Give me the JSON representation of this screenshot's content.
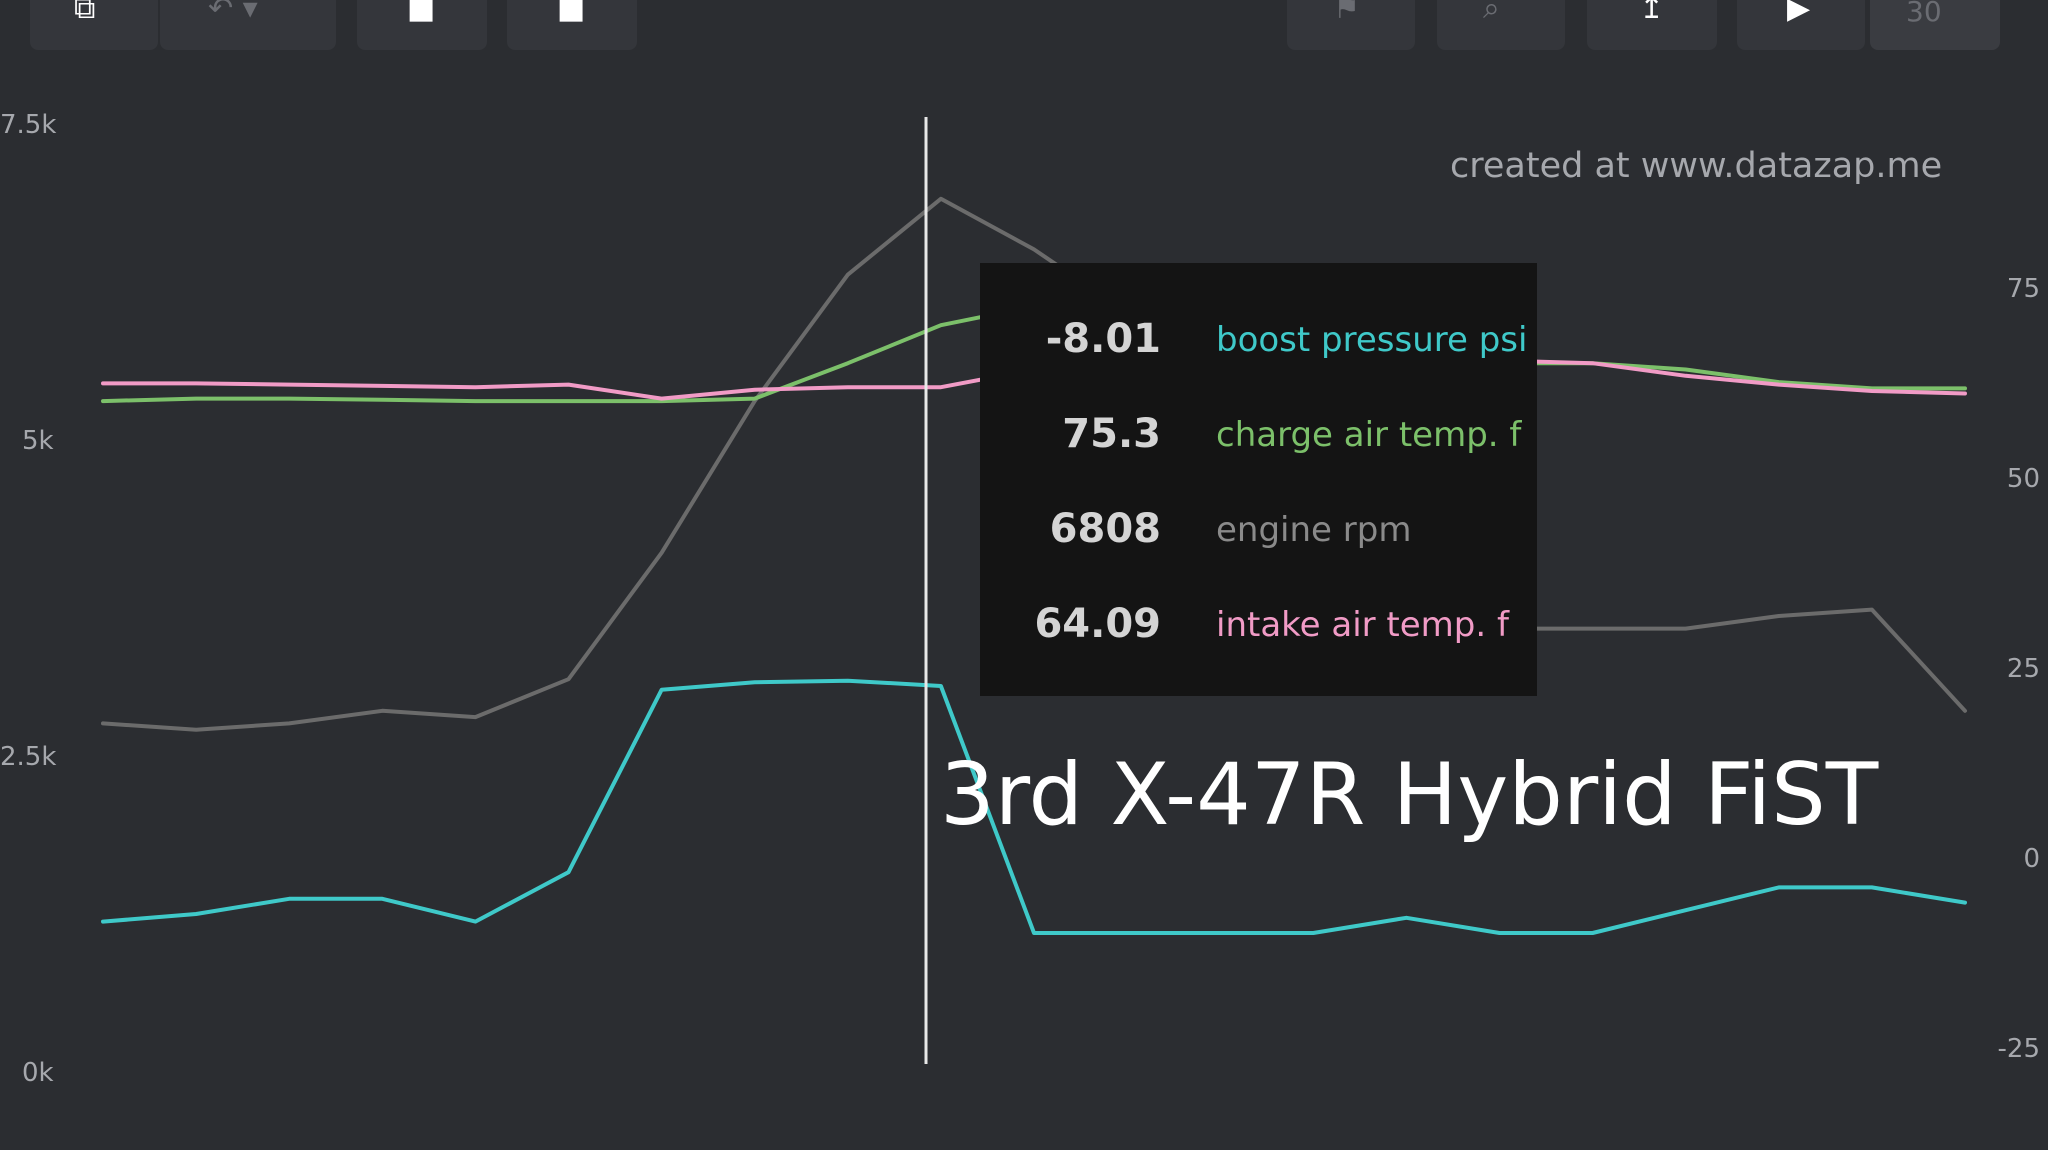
{
  "toolbar": {
    "buttons": [
      {
        "name": "share-icon",
        "glyph": "⧉"
      },
      {
        "name": "undo-icon",
        "glyph": "↶ ▾"
      },
      {
        "name": "square-icon",
        "glyph": "■"
      },
      {
        "name": "square-icon",
        "glyph": "■"
      },
      {
        "name": "flag-icon",
        "glyph": "⚑"
      },
      {
        "name": "search-icon",
        "glyph": "⌕"
      },
      {
        "name": "pin-icon",
        "glyph": "↥"
      },
      {
        "name": "play-icon",
        "glyph": "▶"
      },
      {
        "name": "speed-field",
        "glyph": "30"
      }
    ]
  },
  "watermark": "created at www.datazap.me",
  "title_overlay": "3rd X-47R Hybrid FiST",
  "tooltip": {
    "rows": [
      {
        "value": "-8.01",
        "label": "boost pressure psi",
        "color": "#3fc9c9"
      },
      {
        "value": "75.3",
        "label": "charge air temp. f",
        "color": "#7cc06a"
      },
      {
        "value": "6808",
        "label": "engine rpm",
        "color": "#8a8a8a"
      },
      {
        "value": "64.09",
        "label": "intake air temp. f",
        "color": "#f19bc6"
      }
    ]
  },
  "chart_data": {
    "type": "line",
    "left_axis": {
      "ticks": [
        "7.5k",
        "5k",
        "2.5k",
        "0k"
      ],
      "tick_values": [
        7500,
        5000,
        2500,
        0
      ],
      "ylim": [
        0,
        7500
      ]
    },
    "right_axis": {
      "ticks": [
        "75",
        "50",
        "25",
        "0",
        "-25"
      ],
      "tick_values": [
        75,
        50,
        25,
        0,
        -25
      ],
      "ylim": [
        -25,
        100
      ]
    },
    "x": [
      0,
      0.05,
      0.1,
      0.15,
      0.2,
      0.25,
      0.3,
      0.35,
      0.4,
      0.45,
      0.5,
      0.55,
      0.6,
      0.65,
      0.7,
      0.75,
      0.8,
      0.85,
      0.9,
      0.95,
      1.0
    ],
    "cursor_x": 0.442,
    "series": [
      {
        "name": "engine rpm",
        "axis": "left",
        "color": "#6b6b6b",
        "values": [
          2750,
          2700,
          2750,
          2850,
          2800,
          3100,
          4100,
          5300,
          6300,
          6900,
          6500,
          6000,
          5200,
          4500,
          3650,
          3500,
          3500,
          3500,
          3600,
          3650,
          2850
        ]
      },
      {
        "name": "charge air temp. f",
        "axis": "left",
        "color": "#7cc06a",
        "values": [
          5300,
          5320,
          5320,
          5310,
          5300,
          5300,
          5300,
          5320,
          5600,
          5900,
          6050,
          5900,
          5800,
          5700,
          5650,
          5600,
          5600,
          5550,
          5450,
          5400,
          5400
        ]
      },
      {
        "name": "intake air temp. f",
        "axis": "left",
        "color": "#f19bc6",
        "values": [
          5440,
          5440,
          5430,
          5420,
          5410,
          5430,
          5320,
          5390,
          5410,
          5410,
          5550,
          5600,
          5620,
          5620,
          5620,
          5620,
          5600,
          5500,
          5430,
          5380,
          5360
        ]
      },
      {
        "name": "boost pressure psi",
        "axis": "right",
        "color": "#3fc9c9",
        "values": [
          -8.5,
          -7.5,
          -5.5,
          -5.5,
          -8.5,
          -2,
          22,
          23,
          23.2,
          22.5,
          -10,
          -10,
          -10,
          -10,
          -8,
          -10,
          -10,
          -7,
          -4,
          -4,
          -6
        ]
      }
    ]
  }
}
